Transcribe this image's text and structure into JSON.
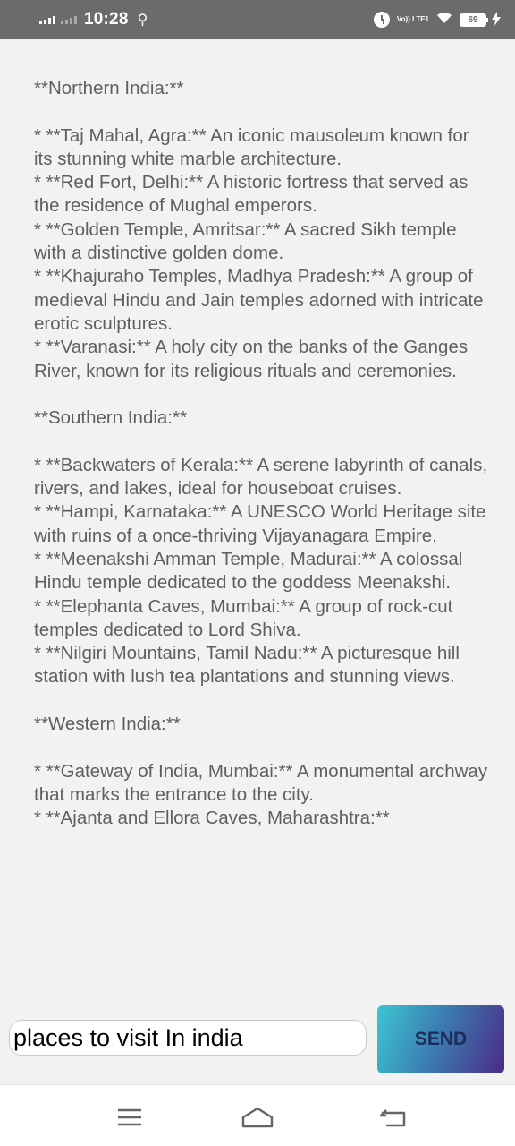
{
  "status_bar": {
    "time": "10:28",
    "battery": "69",
    "volte": "Vo)) LTE1",
    "icons": [
      "signal-icon",
      "usb-icon",
      "alarm-icon",
      "volte-icon",
      "wifi-icon",
      "battery-icon",
      "charging-icon"
    ]
  },
  "response": {
    "sections": [
      {
        "title": "**Northern India:**",
        "body": "* **Taj Mahal, Agra:** An iconic mausoleum known for its stunning white marble architecture.\n* **Red Fort, Delhi:** A historic fortress that served as the residence of Mughal emperors.\n* **Golden Temple, Amritsar:** A sacred Sikh temple with a distinctive golden dome.\n* **Khajuraho Temples, Madhya Pradesh:** A group of medieval Hindu and Jain temples adorned with intricate erotic sculptures.\n* **Varanasi:** A holy city on the banks of the Ganges River, known for its religious rituals and ceremonies."
      },
      {
        "title": "**Southern India:**",
        "body": "* **Backwaters of Kerala:** A serene labyrinth of canals, rivers, and lakes, ideal for houseboat cruises.\n* **Hampi, Karnataka:** A UNESCO World Heritage site with ruins of a once-thriving Vijayanagara Empire.\n* **Meenakshi Amman Temple, Madurai:** A colossal Hindu temple dedicated to the goddess Meenakshi.\n* **Elephanta Caves, Mumbai:** A group of rock-cut temples dedicated to Lord Shiva.\n* **Nilgiri Mountains, Tamil Nadu:** A picturesque hill station with lush tea plantations and stunning views."
      },
      {
        "title": "**Western India:**",
        "body": "* **Gateway of India, Mumbai:** A monumental archway that marks the entrance to the city.\n* **Ajanta and Ellora Caves, Maharashtra:**"
      }
    ]
  },
  "input": {
    "value": "places to visit In india"
  },
  "send_button": {
    "label": "SEND"
  },
  "nav_bar": {
    "icons": [
      "menu-icon",
      "home-icon",
      "back-icon"
    ]
  }
}
